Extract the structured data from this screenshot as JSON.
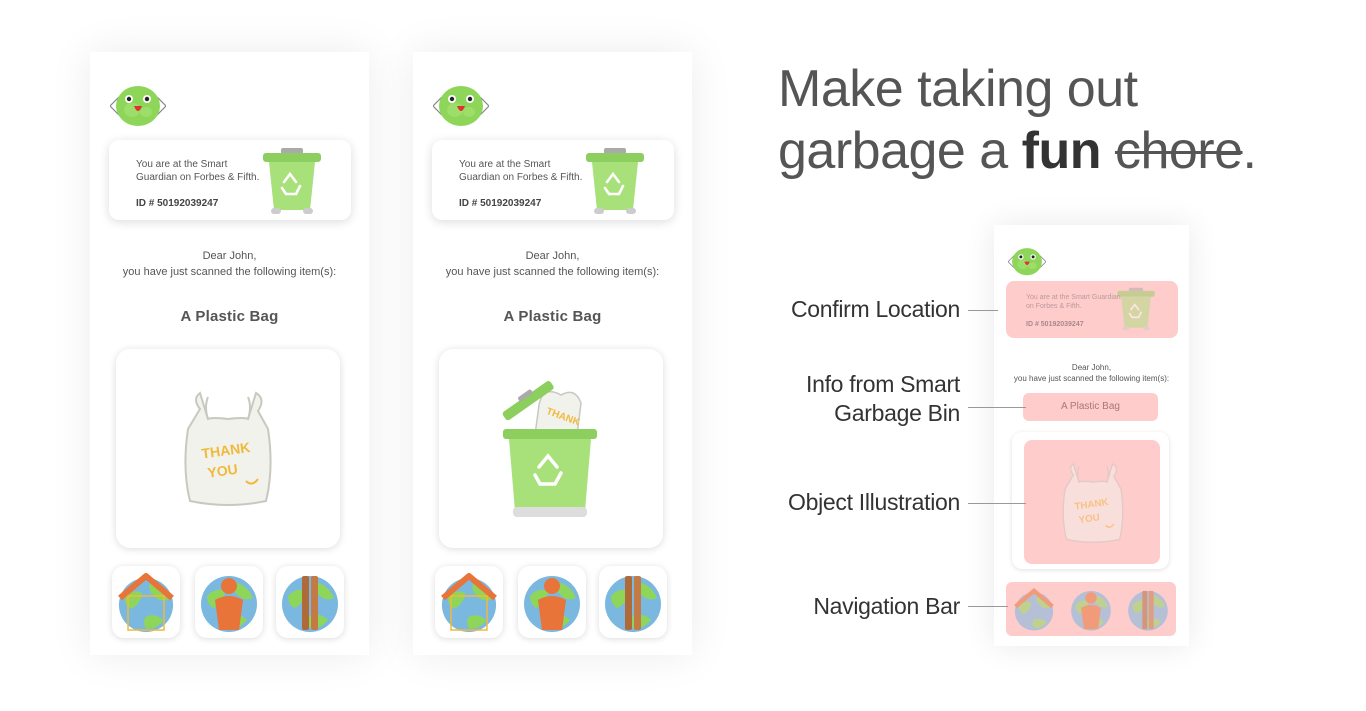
{
  "screens": [
    {
      "location_text": "You are at the Smart Guardian on Forbes & Fifth.",
      "location_id": "ID # 50192039247",
      "greeting_line1": "Dear John,",
      "greeting_line2": "you have just scanned the following item(s):",
      "item_name": "A Plastic Bag",
      "illustration": "plastic-bag",
      "bag_text": "THANK YOU"
    },
    {
      "location_text": "You are at the Smart Guardian on Forbes & Fifth.",
      "location_id": "ID # 50192039247",
      "greeting_line1": "Dear John,",
      "greeting_line2": "you have just scanned the following item(s):",
      "item_name": "A Plastic Bag",
      "illustration": "bag-in-recycling-bin",
      "bag_text": "THANK"
    }
  ],
  "navigation": {
    "items": [
      "home-earth-icon",
      "person-earth-icon",
      "pipes-earth-icon"
    ]
  },
  "headline": {
    "line1": "Make taking out",
    "line2_prefix": "garbage a ",
    "line2_bold": "fun",
    "line2_strike": "chore",
    "line2_end": "."
  },
  "annotated_screen": {
    "location_text": "You are at the Smart Guardian on Forbes & Fifth.",
    "location_id": "ID # 50192039247",
    "greeting_line1": "Dear John,",
    "greeting_line2": "you have just scanned the following item(s):",
    "item_name": "A Plastic Bag",
    "bag_text": "THANK YOU"
  },
  "annotations": {
    "confirm_location": "Confirm Location",
    "info_line1": "Info from Smart",
    "info_line2": "Garbage Bin",
    "object_illustration": "Object Illustration",
    "navigation_bar": "Navigation Bar"
  },
  "colors": {
    "highlight": "#ffcccc",
    "mascot_green": "#8ed65a",
    "bin_green": "#a8e07a",
    "earth_blue": "#7ab8e0",
    "roof_orange": "#e8743a"
  }
}
